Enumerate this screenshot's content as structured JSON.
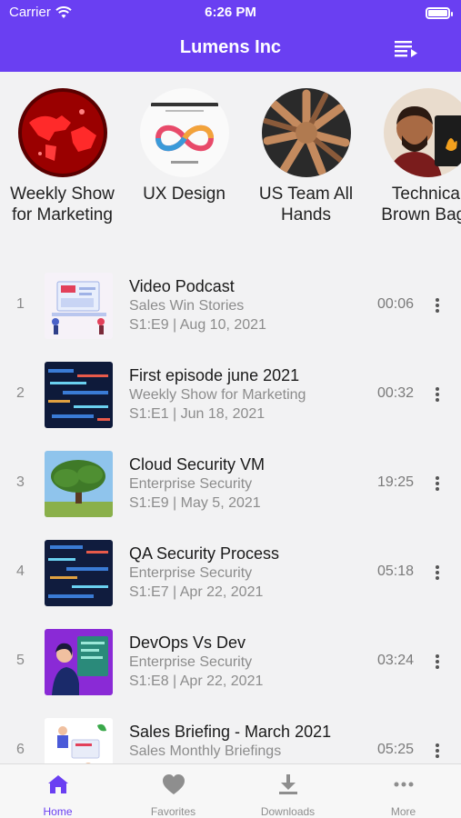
{
  "status_bar": {
    "carrier": "Carrier",
    "time": "6:26 PM"
  },
  "header": {
    "title": "Lumens Inc",
    "queue_icon": "queue-list-icon"
  },
  "channels": [
    {
      "label": "Weekly Show for Marketing"
    },
    {
      "label": "UX Design"
    },
    {
      "label": "US Team All Hands"
    },
    {
      "label": "Technical Brown Bags"
    }
  ],
  "episodes": [
    {
      "index": "1",
      "title": "Video Podcast",
      "show": "Sales Win Stories",
      "meta": "S1:E9 | Aug 10, 2021",
      "duration": "00:06"
    },
    {
      "index": "2",
      "title": "First episode june 2021",
      "show": "Weekly Show for Marketing",
      "meta": "S1:E1 | Jun 18, 2021",
      "duration": "00:32"
    },
    {
      "index": "3",
      "title": "Cloud Security VM",
      "show": "Enterprise Security",
      "meta": "S1:E9 | May 5, 2021",
      "duration": "19:25"
    },
    {
      "index": "4",
      "title": "QA Security Process",
      "show": "Enterprise Security",
      "meta": "S1:E7 | Apr 22, 2021",
      "duration": "05:18"
    },
    {
      "index": "5",
      "title": "DevOps Vs Dev",
      "show": "Enterprise Security",
      "meta": "S1:E8 | Apr 22, 2021",
      "duration": "03:24"
    },
    {
      "index": "6",
      "title": "Sales Briefing - March 2021",
      "show": "Sales Monthly Briefings",
      "meta": "",
      "duration": "05:25"
    }
  ],
  "tabs": [
    {
      "label": "Home",
      "icon": "home-icon"
    },
    {
      "label": "Favorites",
      "icon": "heart-icon"
    },
    {
      "label": "Downloads",
      "icon": "download-icon"
    },
    {
      "label": "More",
      "icon": "more-dots-icon"
    }
  ],
  "colors": {
    "accent": "#6a3ff2",
    "background": "#f2f2f3"
  }
}
